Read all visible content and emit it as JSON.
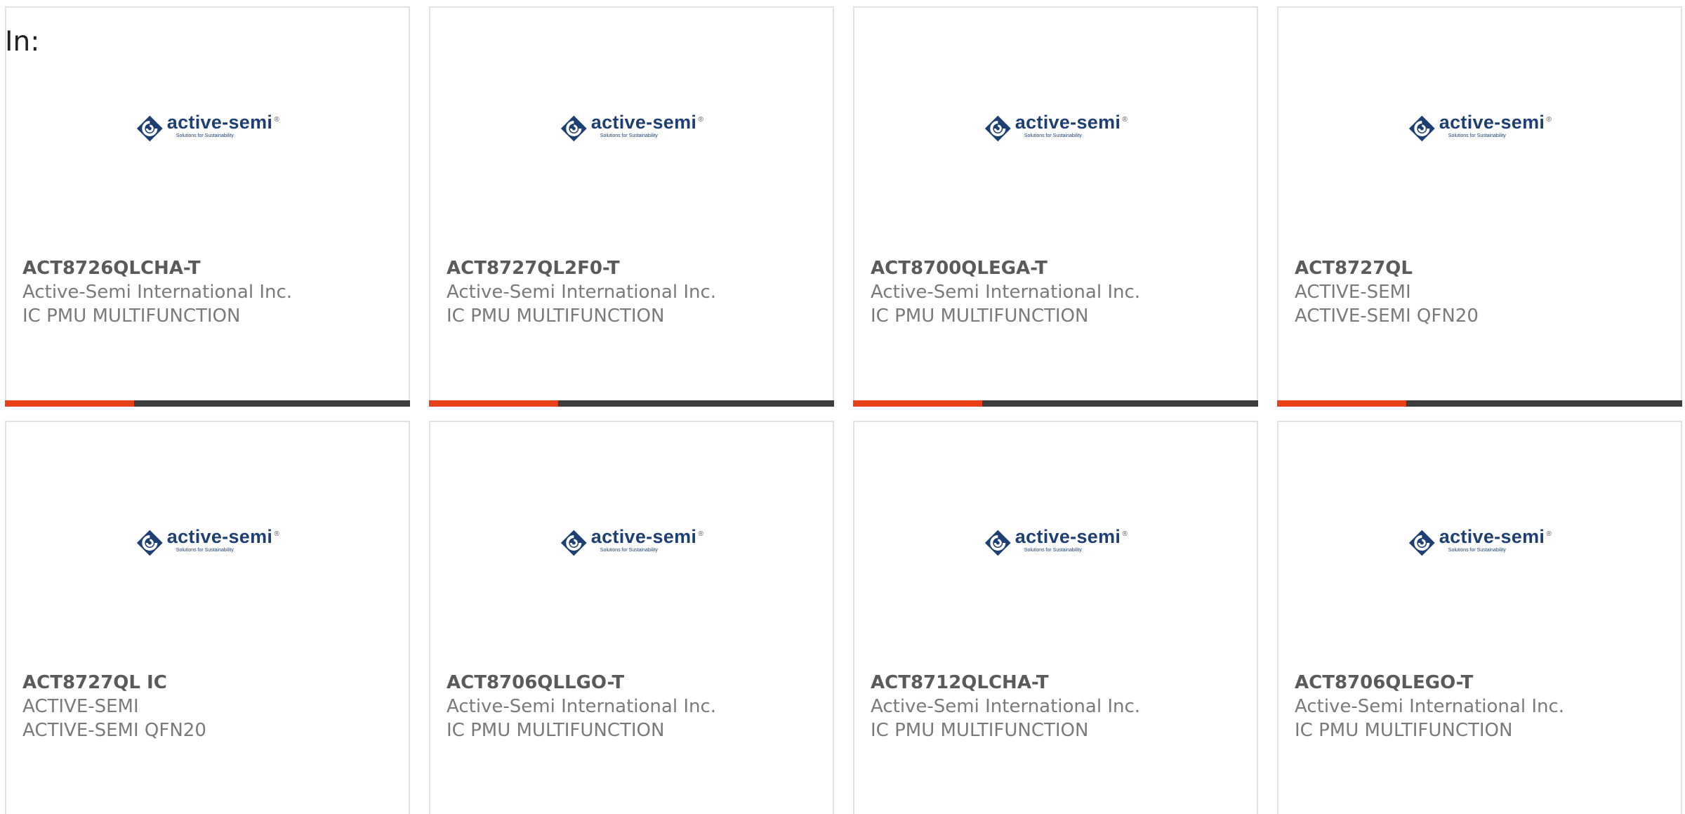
{
  "header": {
    "label": "In:"
  },
  "logo": {
    "name": "active-semi",
    "registered": "®",
    "tagline": "Solutions for Sustainability"
  },
  "colors": {
    "accent": "#e7401a",
    "bar": "#3d3d3d",
    "logo_blue": "#1d3f74"
  },
  "products": [
    {
      "part": "ACT8726QLCHA-T",
      "manufacturer": "Active-Semi International Inc.",
      "description": "IC PMU MULTIFUNCTION"
    },
    {
      "part": "ACT8727QL2F0-T",
      "manufacturer": "Active-Semi International Inc.",
      "description": "IC PMU MULTIFUNCTION"
    },
    {
      "part": "ACT8700QLEGA-T",
      "manufacturer": "Active-Semi International Inc.",
      "description": "IC PMU MULTIFUNCTION"
    },
    {
      "part": "ACT8727QL",
      "manufacturer": "ACTIVE-SEMI",
      "description": "ACTIVE-SEMI QFN20"
    },
    {
      "part": "ACT8727QL IC",
      "manufacturer": "ACTIVE-SEMI",
      "description": "ACTIVE-SEMI QFN20"
    },
    {
      "part": "ACT8706QLLGO-T",
      "manufacturer": "Active-Semi International Inc.",
      "description": "IC PMU MULTIFUNCTION"
    },
    {
      "part": "ACT8712QLCHA-T",
      "manufacturer": "Active-Semi International Inc.",
      "description": "IC PMU MULTIFUNCTION"
    },
    {
      "part": "ACT8706QLEGO-T",
      "manufacturer": "Active-Semi International Inc.",
      "description": "IC PMU MULTIFUNCTION"
    }
  ]
}
